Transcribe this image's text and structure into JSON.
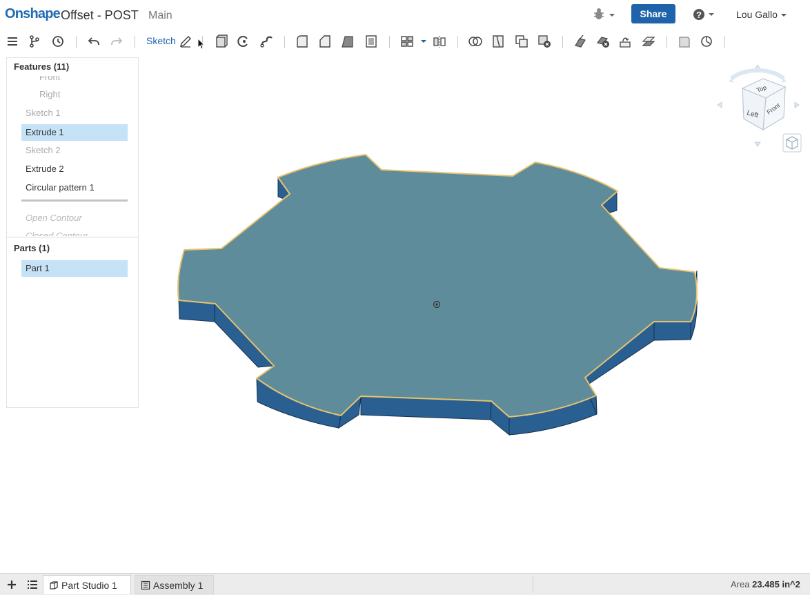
{
  "header": {
    "logo": "Onshape",
    "document_title": "Offset - POST",
    "branch": "Main",
    "share_label": "Share",
    "user_name": "Lou Gallo"
  },
  "toolbar": {
    "sketch_label": "Sketch",
    "icons": [
      "menu-icon",
      "version-graph-icon",
      "history-icon",
      "undo-icon",
      "redo-icon",
      "sketch-pencil-icon",
      "extrude-icon",
      "revolve-icon",
      "sweep-icon",
      "fillet-icon",
      "chamfer-icon",
      "draft-icon",
      "shell-icon",
      "pattern-icon",
      "mirror-icon",
      "boolean-icon",
      "split-icon",
      "transform-icon",
      "delete-part-icon",
      "move-face-icon",
      "delete-face-icon",
      "replace-face-icon",
      "offset-surface-icon",
      "plane-icon",
      "helix-icon"
    ]
  },
  "features": {
    "header": "Features (11)",
    "items": [
      {
        "label": "Front",
        "state": "dim"
      },
      {
        "label": "Right",
        "state": "dim"
      },
      {
        "label": "Sketch 1",
        "state": "dim"
      },
      {
        "label": "Extrude 1",
        "state": "selected"
      },
      {
        "label": "Sketch 2",
        "state": "dim"
      },
      {
        "label": "Extrude 2",
        "state": "normal"
      },
      {
        "label": "Circular pattern 1",
        "state": "normal"
      }
    ],
    "suppressed": [
      {
        "label": "Open Contour"
      },
      {
        "label": "Closed Contour"
      }
    ]
  },
  "parts": {
    "header": "Parts (1)",
    "items": [
      {
        "label": "Part 1",
        "state": "selected"
      }
    ]
  },
  "view_cube": {
    "top": "Top",
    "left": "Left",
    "front": "Front"
  },
  "bottom": {
    "tabs": [
      {
        "label": "Part Studio 1",
        "active": true,
        "icon": "part-studio-icon"
      },
      {
        "label": "Assembly 1",
        "active": false,
        "icon": "assembly-icon"
      }
    ],
    "status_label": "Area",
    "status_value": "23.485 in^2"
  },
  "colors": {
    "brand": "#1f6bb4",
    "share_button": "#1f63ab",
    "selection": "#c5e2f6",
    "part_top": "#5f8c9a",
    "part_side": "#2a5f92",
    "highlight_edge": "#e8c36e"
  }
}
